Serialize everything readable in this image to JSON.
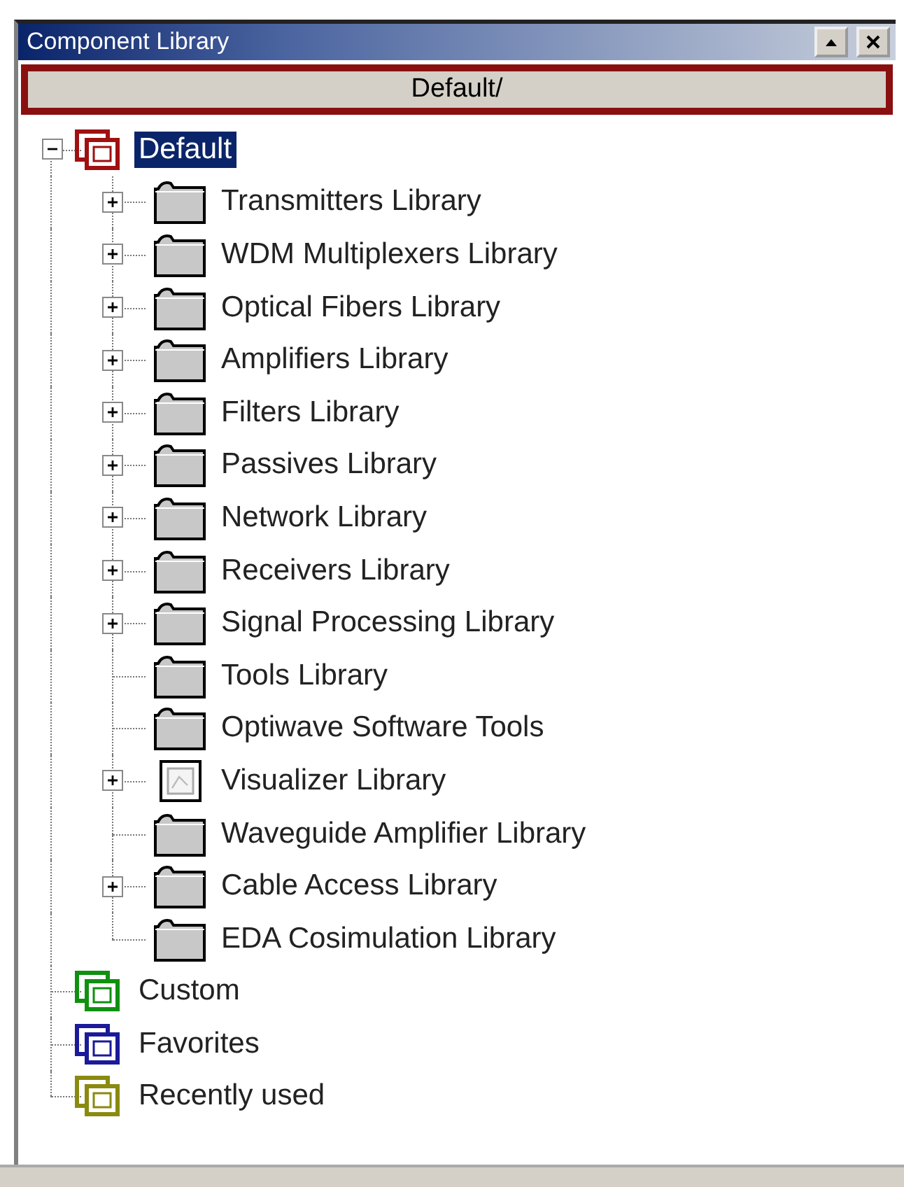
{
  "window": {
    "title": "Component Library"
  },
  "path_button": {
    "label": "Default/"
  },
  "tree": [
    {
      "label": "Default",
      "color": "#a01010",
      "selected": true,
      "expanded": true,
      "children": [
        {
          "label": "Transmitters Library",
          "kind": "folder",
          "expandable": true
        },
        {
          "label": "WDM Multiplexers Library",
          "kind": "folder",
          "expandable": true
        },
        {
          "label": "Optical Fibers Library",
          "kind": "folder",
          "expandable": true
        },
        {
          "label": "Amplifiers Library",
          "kind": "folder",
          "expandable": true
        },
        {
          "label": "Filters Library",
          "kind": "folder",
          "expandable": true
        },
        {
          "label": "Passives Library",
          "kind": "folder",
          "expandable": true
        },
        {
          "label": "Network Library",
          "kind": "folder",
          "expandable": true
        },
        {
          "label": "Receivers Library",
          "kind": "folder",
          "expandable": true
        },
        {
          "label": "Signal Processing Library",
          "kind": "folder",
          "expandable": true
        },
        {
          "label": "Tools Library",
          "kind": "folder",
          "expandable": false
        },
        {
          "label": "Optiwave Software Tools",
          "kind": "folder",
          "expandable": false
        },
        {
          "label": "Visualizer Library",
          "kind": "visualizer",
          "expandable": true
        },
        {
          "label": "Waveguide Amplifier Library",
          "kind": "folder",
          "expandable": false
        },
        {
          "label": "Cable Access Library",
          "kind": "folder",
          "expandable": true
        },
        {
          "label": "EDA Cosimulation Library",
          "kind": "folder",
          "expandable": false
        }
      ]
    },
    {
      "label": "Custom",
      "color": "#109010",
      "selected": false
    },
    {
      "label": "Favorites",
      "color": "#1a1a9a",
      "selected": false
    },
    {
      "label": "Recently used",
      "color": "#8a8a10",
      "selected": false
    }
  ]
}
